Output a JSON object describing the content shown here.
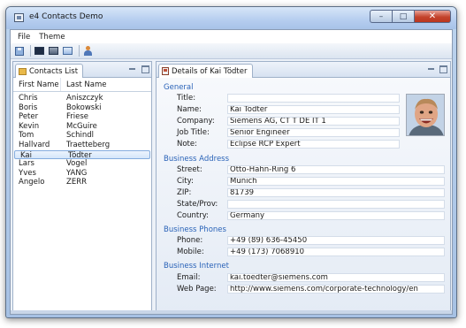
{
  "window": {
    "title": "e4 Contacts Demo"
  },
  "menu": [
    "File",
    "Theme"
  ],
  "toolbar": {
    "icons": [
      "save-icon",
      "dark-theme-icon",
      "gray-theme-icon",
      "blue-theme-icon",
      "person-icon"
    ]
  },
  "contacts_panel": {
    "tab_label": "Contacts List",
    "columns": [
      "First Name",
      "Last Name"
    ],
    "rows": [
      [
        "Chris",
        "Aniszczyk"
      ],
      [
        "Boris",
        "Bokowski"
      ],
      [
        "Peter",
        "Friese"
      ],
      [
        "Kevin",
        "McGuire"
      ],
      [
        "Tom",
        "Schindl"
      ],
      [
        "Hallvard",
        "Traetteberg"
      ],
      [
        "Kai",
        "Tödter"
      ],
      [
        "Lars",
        "Vogel"
      ],
      [
        "Yves",
        "YANG"
      ],
      [
        "Angelo",
        "ZERR"
      ]
    ],
    "selected_index": 6
  },
  "details_panel": {
    "tab_label": "Details of Kai Tödter",
    "sections": {
      "general": "General",
      "business_address": "Business Address",
      "business_phones": "Business Phones",
      "business_internet": "Business Internet"
    },
    "labels": {
      "title": "Title:",
      "name": "Name:",
      "company": "Company:",
      "job_title": "Job Title:",
      "note": "Note:",
      "street": "Street:",
      "city": "City:",
      "zip": "ZIP:",
      "state": "State/Prov:",
      "country": "Country:",
      "phone": "Phone:",
      "mobile": "Mobile:",
      "email": "Email:",
      "web_page": "Web Page:"
    },
    "values": {
      "title": "",
      "name": "Kai Tödter",
      "company": "Siemens AG, CT T DE IT 1",
      "job_title": "Senior Engineer",
      "note": "Eclipse RCP Expert",
      "street": "Otto-Hahn-Ring 6",
      "city": "Munich",
      "zip": "81739",
      "state": "",
      "country": "Germany",
      "phone": "+49 (89) 636-45450",
      "mobile": "+49 (173) 7068910",
      "email": "kai.toedter@siemens.com",
      "web_page": "http://www.siemens.com/corporate-technology/en"
    }
  }
}
